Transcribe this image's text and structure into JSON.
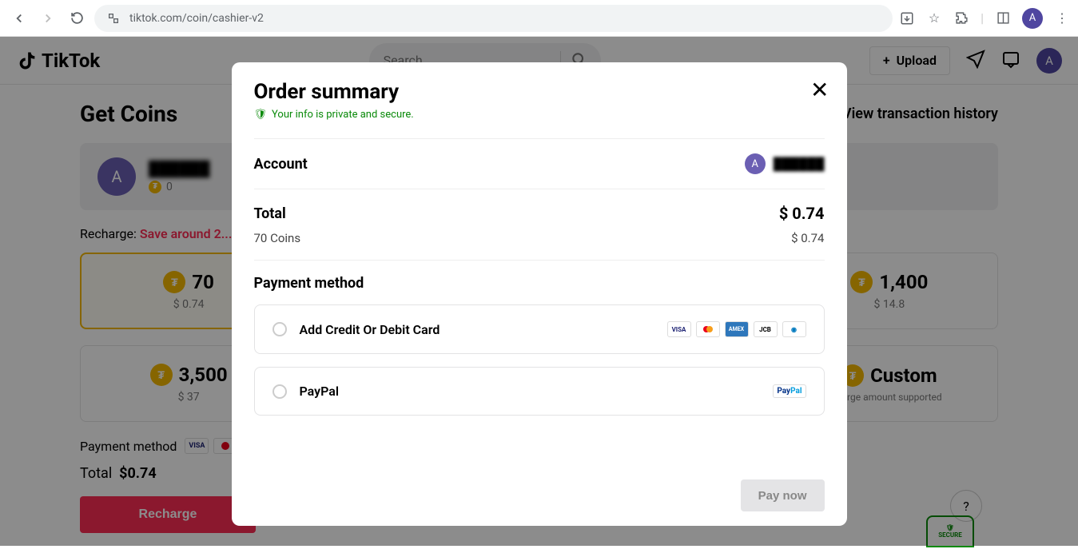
{
  "browser": {
    "url": "tiktok.com/coin/cashier-v2",
    "avatar_letter": "A"
  },
  "header": {
    "brand": "TikTok",
    "search_placeholder": "Search",
    "upload_label": "Upload",
    "avatar_letter": "A"
  },
  "page": {
    "title": "Get Coins",
    "history_link": "View transaction history",
    "account_letter": "A",
    "account_name": "██████",
    "account_coins": "0",
    "recharge_label": "Recharge:",
    "recharge_save": "Save around 2...",
    "coin_options": [
      {
        "amount": "70",
        "price": "$ 0.74",
        "selected": true
      },
      {
        "amount": "1,400",
        "price": "$ 14.8",
        "selected": false
      },
      {
        "amount": "3,500",
        "price": "$ 37",
        "selected": false
      },
      {
        "amount": "Custom",
        "price": "",
        "sub": "Large amount supported",
        "selected": false
      }
    ],
    "payment_method_label": "Payment method",
    "total_label": "Total",
    "total_amount": "$0.74",
    "recharge_btn": "Recharge",
    "secure_badge": "SECURE"
  },
  "modal": {
    "title": "Order summary",
    "secure_msg": "Your info is private and secure.",
    "account_label": "Account",
    "account_letter": "A",
    "account_name": "██████",
    "total_label": "Total",
    "total_amount": "$ 0.74",
    "coins_line": "70 Coins",
    "coins_price": "$ 0.74",
    "pm_label": "Payment method",
    "pm_options": [
      {
        "label": "Add Credit Or Debit Card",
        "cards": [
          "VISA",
          "MC",
          "AMEX",
          "JCB",
          "DC"
        ]
      },
      {
        "label": "PayPal",
        "brand": "PP"
      }
    ],
    "pay_btn": "Pay now"
  }
}
